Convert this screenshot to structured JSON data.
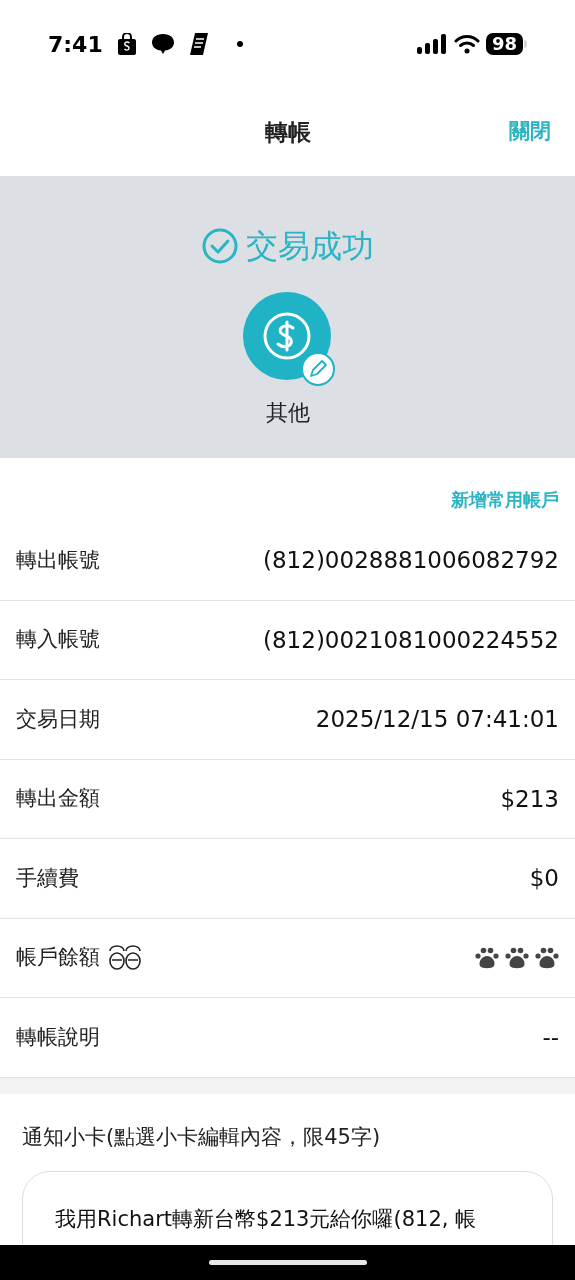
{
  "status_bar": {
    "time": "7:41",
    "battery": "98"
  },
  "header": {
    "title": "轉帳",
    "close": "關閉"
  },
  "result": {
    "title": "交易成功",
    "category": "其他"
  },
  "add_account_link": "新增常用帳戶",
  "rows": [
    {
      "kind": "text",
      "label": "轉出帳號",
      "value": "(812)0028881006082792"
    },
    {
      "kind": "text",
      "label": "轉入帳號",
      "value": "(812)0021081000224552"
    },
    {
      "kind": "text",
      "label": "交易日期",
      "value": "2025/12/15 07:41:01"
    },
    {
      "kind": "text",
      "label": "轉出金額",
      "value": "$213"
    },
    {
      "kind": "text",
      "label": "手續費",
      "value": "$0"
    },
    {
      "kind": "masked",
      "label": "帳戶餘額"
    },
    {
      "kind": "text",
      "label": "轉帳說明",
      "value": "--"
    }
  ],
  "notice_card": {
    "caption": "通知小卡(點選小卡編輯內容，限45字)",
    "message": "我用Richart轉新台幣$213元給你囉(812, 帳"
  }
}
